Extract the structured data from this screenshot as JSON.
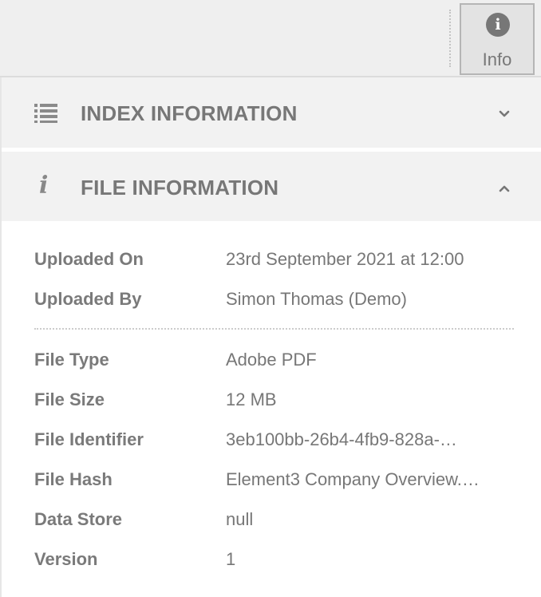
{
  "toolbar": {
    "info_button": {
      "label": "Info",
      "icon": "info-circle-icon"
    }
  },
  "sections": {
    "index": {
      "title": "INDEX INFORMATION",
      "icon": "list-icon",
      "expanded": false
    },
    "file": {
      "title": "FILE INFORMATION",
      "icon": "info-italic-icon",
      "expanded": true
    }
  },
  "file_info": {
    "uploaded_on": {
      "label": "Uploaded On",
      "value": "23rd September 2021 at 12:00"
    },
    "uploaded_by": {
      "label": "Uploaded By",
      "value": "Simon Thomas (Demo)"
    },
    "file_type": {
      "label": "File Type",
      "value": "Adobe PDF"
    },
    "file_size": {
      "label": "File Size",
      "value": "12 MB"
    },
    "file_identifier": {
      "label": "File Identifier",
      "value": "3eb100bb-26b4-4fb9-828a-…"
    },
    "file_hash": {
      "label": "File Hash",
      "value": "Element3 Company Overview.pdf"
    },
    "data_store": {
      "label": "Data Store",
      "value": "null"
    },
    "version": {
      "label": "Version",
      "value": "1"
    }
  }
}
